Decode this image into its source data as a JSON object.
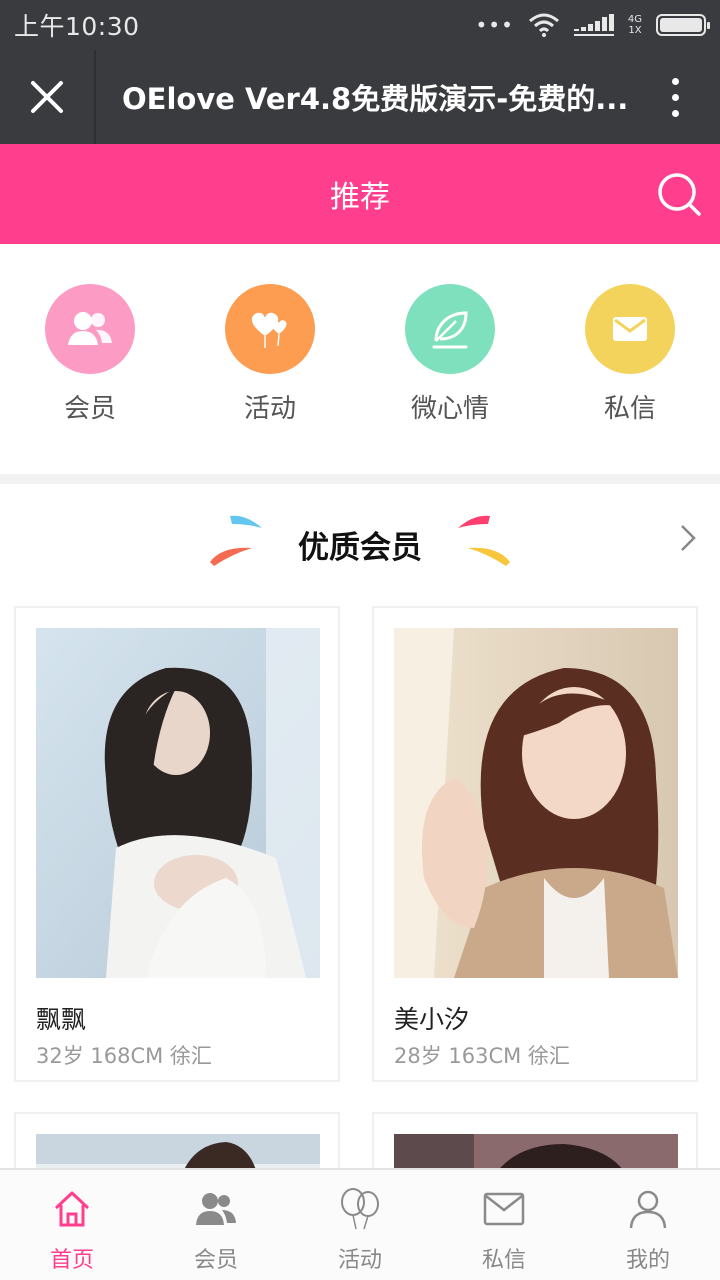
{
  "status_bar": {
    "time": "上午10:30",
    "network_top": "4G",
    "network_bottom": "1X",
    "dots": "•••"
  },
  "title_bar": {
    "title": "OElove Ver4.8免费版演示-免费的..."
  },
  "header": {
    "title": "推荐",
    "accent": "#ff3f8d"
  },
  "quick_links": [
    {
      "label": "会员",
      "icon": "members-icon",
      "color": "#fc9cc5"
    },
    {
      "label": "活动",
      "icon": "balloon-hearts-icon",
      "color": "#fc9d52"
    },
    {
      "label": "微心情",
      "icon": "feather-icon",
      "color": "#7fe0bd"
    },
    {
      "label": "私信",
      "icon": "mail-icon",
      "color": "#f4d35d"
    }
  ],
  "section": {
    "title": "优质会员"
  },
  "members": [
    {
      "name": "飘飘",
      "info": "32岁 168CM 徐汇"
    },
    {
      "name": "美小汐",
      "info": "28岁 163CM 徐汇"
    }
  ],
  "bottom_nav": [
    {
      "label": "首页",
      "icon": "home-icon",
      "active": true
    },
    {
      "label": "会员",
      "icon": "members-icon",
      "active": false
    },
    {
      "label": "活动",
      "icon": "balloon-icon",
      "active": false
    },
    {
      "label": "私信",
      "icon": "mail-icon",
      "active": false
    },
    {
      "label": "我的",
      "icon": "user-icon",
      "active": false
    }
  ]
}
